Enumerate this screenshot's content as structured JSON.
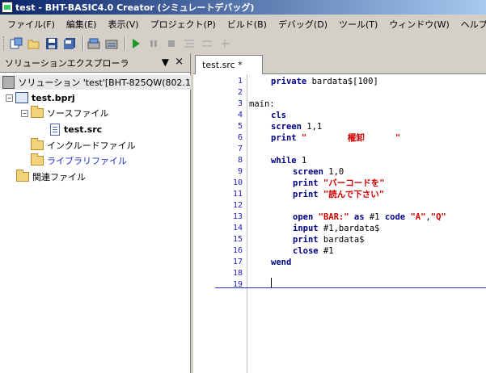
{
  "window": {
    "title": "test - BHT-BASIC4.0 Creator (シミュレートデバッグ)"
  },
  "menu": [
    {
      "label": "ファイル(F)",
      "name": "menu-file"
    },
    {
      "label": "編集(E)",
      "name": "menu-edit"
    },
    {
      "label": "表示(V)",
      "name": "menu-view"
    },
    {
      "label": "プロジェクト(P)",
      "name": "menu-project"
    },
    {
      "label": "ビルド(B)",
      "name": "menu-build"
    },
    {
      "label": "デバッグ(D)",
      "name": "menu-debug"
    },
    {
      "label": "ツール(T)",
      "name": "menu-tools"
    },
    {
      "label": "ウィンドウ(W)",
      "name": "menu-window"
    },
    {
      "label": "ヘルプ(H)",
      "name": "menu-help"
    }
  ],
  "explorer": {
    "title": "ソリューションエクスプローラ",
    "pin_glyph": "▼",
    "close_glyph": "×",
    "solution": "ソリューション 'test'[BHT-825QW(802.1",
    "project": "test.bprj",
    "source_folder": "ソースファイル",
    "source_file": "test.src",
    "include_folder": "インクルードファイル",
    "library_folder": "ライブラリファイル",
    "related_folder": "関連ファイル",
    "expander_minus": "−"
  },
  "editor": {
    "tab_label": "test.src *",
    "line_numbers": [
      "1",
      "2",
      "3",
      "4",
      "5",
      "6",
      "7",
      "8",
      "9",
      "10",
      "11",
      "12",
      "13",
      "14",
      "15",
      "16",
      "17",
      "18",
      "19"
    ]
  },
  "code": {
    "l1_kw": "private",
    "l1_rest": " bardata$[100]",
    "l3": "main:",
    "l4_kw": "cls",
    "l5_kw": "screen",
    "l5_rest": " 1,1",
    "l6_kw": "print",
    "l6_str": " \"        櫂卸      \"",
    "l8_kw": "while",
    "l8_rest": " 1",
    "l9_kw": "screen",
    "l9_rest": " 1,0",
    "l10_kw": "print",
    "l10_str": " \"バーコードを\"",
    "l11_kw": "print",
    "l11_str": " \"読んで下さい\"",
    "l13_kw1": "open",
    "l13_str1": " \"BAR:\"",
    "l13_kw2": " as",
    "l13_rest1": " #1 ",
    "l13_kw3": "code",
    "l13_str2": " \"A\"",
    "l13_rest2": ",",
    "l13_str3": "\"Q\"",
    "l14_kw": "input",
    "l14_rest": " #1,bardata$",
    "l15_kw": "print",
    "l15_rest": " bardata$",
    "l16_kw": "close",
    "l16_rest": " #1",
    "l17_kw": "wend"
  }
}
